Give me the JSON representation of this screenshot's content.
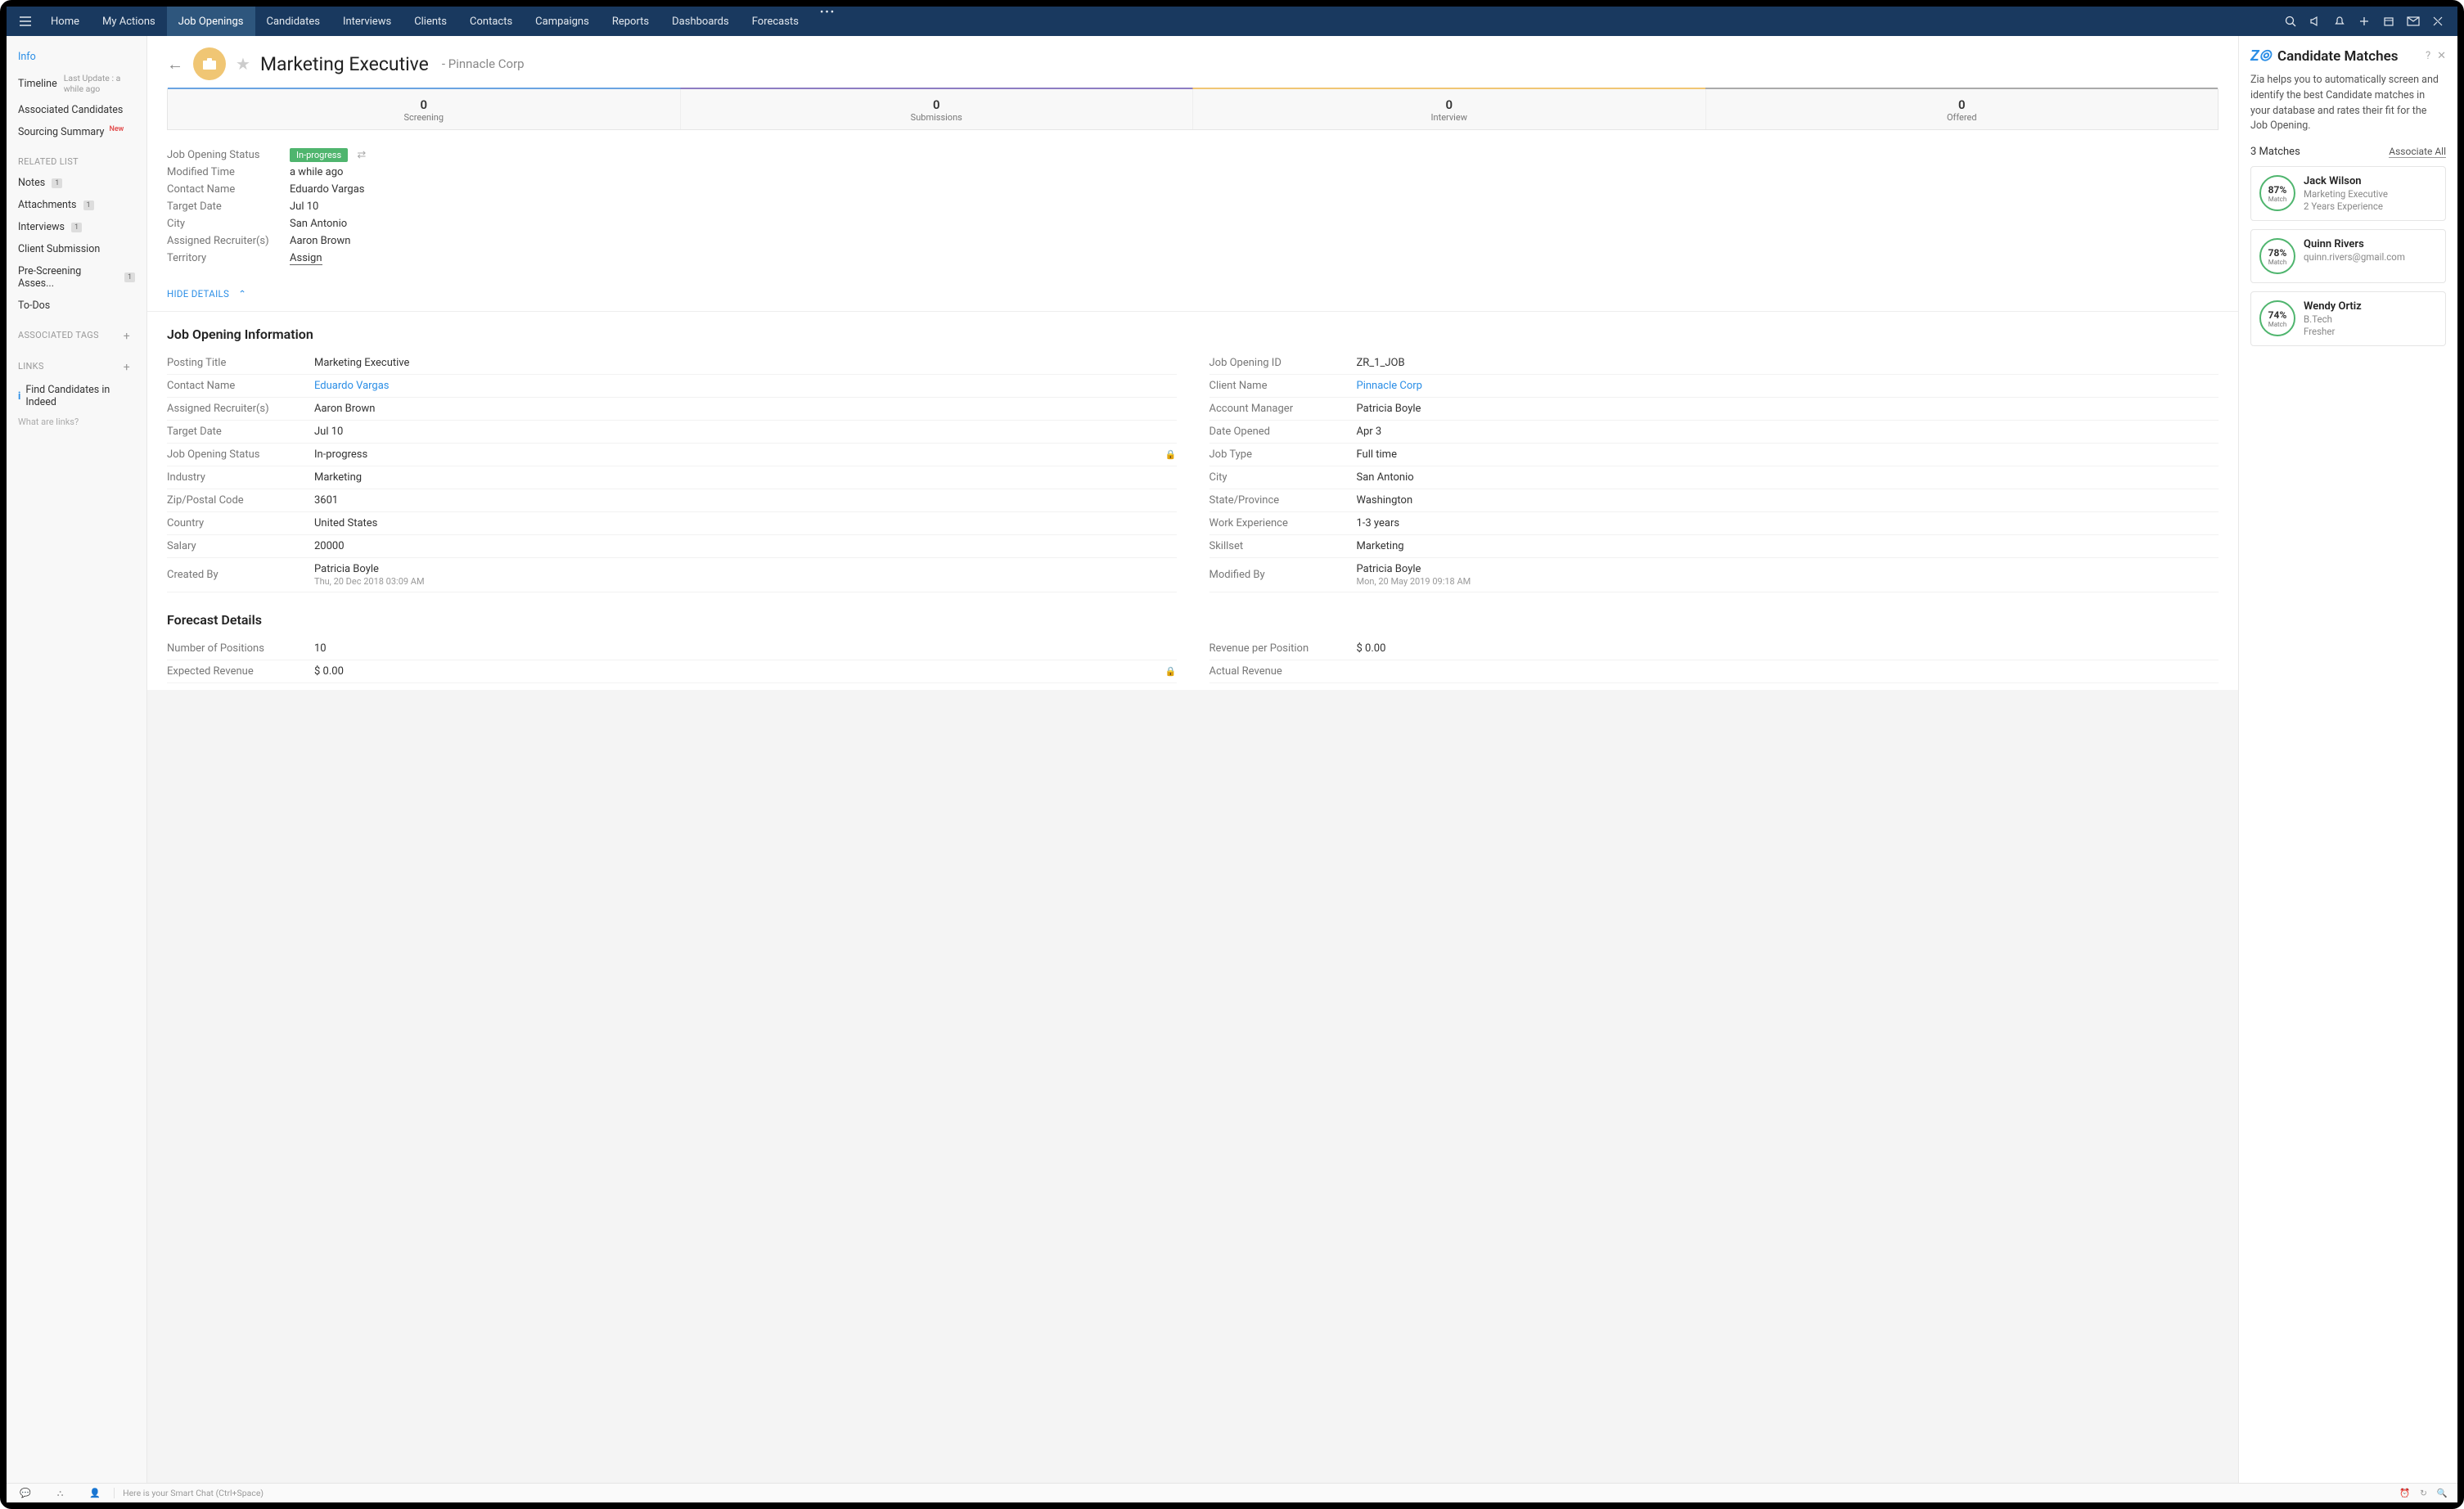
{
  "topnav": {
    "items": [
      "Home",
      "My Actions",
      "Job Openings",
      "Candidates",
      "Interviews",
      "Clients",
      "Contacts",
      "Campaigns",
      "Reports",
      "Dashboards",
      "Forecasts"
    ],
    "activeIndex": 2
  },
  "sidebar": {
    "info": "Info",
    "timeline": "Timeline",
    "timeline_sub": "Last Update : a while ago",
    "associated": "Associated Candidates",
    "sourcing": "Sourcing Summary",
    "new_label": "New",
    "related_list": "RELATED LIST",
    "notes": "Notes",
    "notes_count": "1",
    "attachments": "Attachments",
    "attachments_count": "1",
    "interviews": "Interviews",
    "interviews_count": "1",
    "client_submission": "Client Submission",
    "prescreen": "Pre-Screening Asses...",
    "prescreen_count": "1",
    "todos": "To-Dos",
    "associated_tags": "ASSOCIATED TAGS",
    "links": "LINKS",
    "find_indeed": "Find Candidates in Indeed",
    "what_links": "What are links?"
  },
  "record": {
    "title": "Marketing Executive",
    "subtitle": "Pinnacle Corp"
  },
  "pipeline": [
    {
      "count": "0",
      "label": "Screening"
    },
    {
      "count": "0",
      "label": "Submissions"
    },
    {
      "count": "0",
      "label": "Interview"
    },
    {
      "count": "0",
      "label": "Offered"
    }
  ],
  "summary": {
    "status_label": "Job Opening Status",
    "status_value": "In-progress",
    "modified_label": "Modified Time",
    "modified_value": "a while ago",
    "contact_label": "Contact Name",
    "contact_value": "Eduardo Vargas",
    "target_label": "Target Date",
    "target_value": "Jul 10",
    "city_label": "City",
    "city_value": "San Antonio",
    "recruiter_label": "Assigned Recruiter(s)",
    "recruiter_value": "Aaron Brown",
    "territory_label": "Territory",
    "territory_value": "Assign"
  },
  "hide_details": "HIDE DETAILS",
  "job_info_heading": "Job Opening Information",
  "job_info_left": [
    {
      "label": "Posting Title",
      "value": "Marketing Executive"
    },
    {
      "label": "Contact Name",
      "value": "Eduardo Vargas",
      "link": true
    },
    {
      "label": "Assigned Recruiter(s)",
      "value": "Aaron Brown"
    },
    {
      "label": "Target Date",
      "value": "Jul 10"
    },
    {
      "label": "Job Opening Status",
      "value": "In-progress",
      "lock": true
    },
    {
      "label": "Industry",
      "value": "Marketing"
    },
    {
      "label": "Zip/Postal Code",
      "value": "3601"
    },
    {
      "label": "Country",
      "value": "United States"
    },
    {
      "label": "Salary",
      "value": "20000"
    },
    {
      "label": "Created By",
      "value": "Patricia Boyle",
      "sub": "Thu, 20 Dec 2018 03:09 AM"
    }
  ],
  "job_info_right": [
    {
      "label": "Job Opening ID",
      "value": "ZR_1_JOB"
    },
    {
      "label": "Client Name",
      "value": "Pinnacle Corp",
      "link": true
    },
    {
      "label": "Account Manager",
      "value": "Patricia Boyle"
    },
    {
      "label": "Date Opened",
      "value": "Apr 3"
    },
    {
      "label": "Job Type",
      "value": "Full time"
    },
    {
      "label": "City",
      "value": "San Antonio"
    },
    {
      "label": "State/Province",
      "value": "Washington"
    },
    {
      "label": "Work Experience",
      "value": "1-3 years"
    },
    {
      "label": "Skillset",
      "value": "Marketing"
    },
    {
      "label": "Modified By",
      "value": "Patricia Boyle",
      "sub": "Mon, 20 May 2019 09:18 AM"
    }
  ],
  "forecast_heading": "Forecast Details",
  "forecast_left": [
    {
      "label": "Number of Positions",
      "value": "10"
    },
    {
      "label": "Expected Revenue",
      "value": "$ 0.00",
      "lock": true
    }
  ],
  "forecast_right": [
    {
      "label": "Revenue per Position",
      "value": "$ 0.00"
    },
    {
      "label": "Actual Revenue",
      "value": ""
    }
  ],
  "right_panel": {
    "title": "Candidate Matches",
    "desc": "Zia helps you to automatically screen and identify the best Candidate matches in your database and rates their fit for the Job Opening.",
    "count": "3 Matches",
    "associate_all": "Associate All",
    "matches": [
      {
        "pct": "87%",
        "match": "Match",
        "name": "Jack Wilson",
        "line1": "Marketing Executive",
        "line2": "2 Years Experience"
      },
      {
        "pct": "78%",
        "match": "Match",
        "name": "Quinn Rivers",
        "line1": "quinn.rivers@gmail.com",
        "line2": ""
      },
      {
        "pct": "74%",
        "match": "Match",
        "name": "Wendy Ortiz",
        "line1": "B.Tech",
        "line2": "Fresher"
      }
    ]
  },
  "bottom": {
    "chat_hint": "Here is your Smart Chat (Ctrl+Space)"
  }
}
